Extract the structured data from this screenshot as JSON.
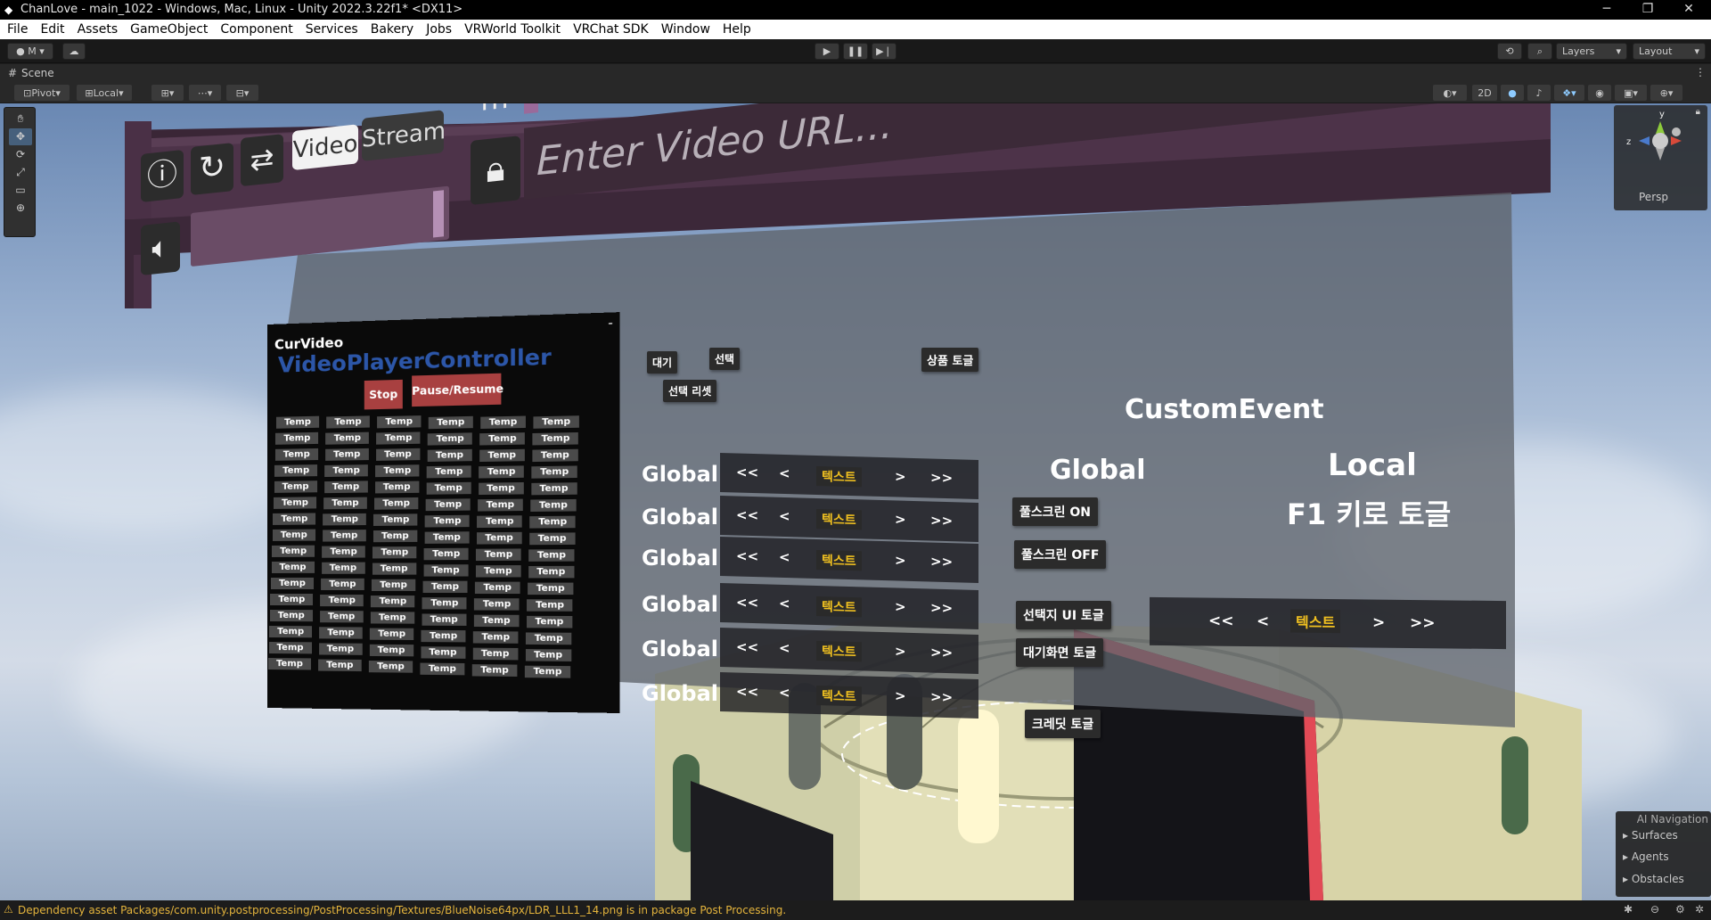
{
  "window": {
    "title": "ChanLove - main_1022 - Windows, Mac, Linux - Unity 2022.3.22f1* <DX11>",
    "minimize": "─",
    "maximize": "❐",
    "close": "✕"
  },
  "menu": [
    "File",
    "Edit",
    "Assets",
    "GameObject",
    "Component",
    "Services",
    "Bakery",
    "Jobs",
    "VRWorld Toolkit",
    "VRChat SDK",
    "Window",
    "Help"
  ],
  "toolbar": {
    "account": "M",
    "layers": "Layers",
    "layout": "Layout"
  },
  "scene": {
    "tab_label": "Scene",
    "pivot": "Pivot",
    "local": "Local",
    "two_d": "2D",
    "persp": "Persp"
  },
  "ai_navigation": {
    "title": "AI Navigation",
    "items": [
      "Surfaces",
      "Agents",
      "Obstacles"
    ]
  },
  "video_player": {
    "tab_video": "Video",
    "tab_stream": "Stream",
    "url_placeholder": "Enter Video URL..."
  },
  "curvideo": {
    "title": "CurVideo",
    "subtitle": "VideoPlayerController",
    "stop": "Stop",
    "pause_resume": "Pause/Resume",
    "cell": "Temp",
    "rows": 16,
    "cols": 6
  },
  "buttons": {
    "wait": "대기",
    "select": "선택",
    "select_reset": "선택 리셋",
    "product_toggle": "상품 토글",
    "fullscreen_on": "풀스크린 ON",
    "fullscreen_off": "풀스크린 OFF",
    "intro_ui_toggle": "선택지 UI 토글",
    "standby_toggle": "대기화면 토글",
    "credit_toggle": "크레딧 토글"
  },
  "headings": {
    "custom_event": "CustomEvent",
    "global": "Global",
    "local": "Local",
    "f1_toggle": "F1 키로 토글"
  },
  "row_label": "Global",
  "row_controls": {
    "first": "<<",
    "prev": "<",
    "text": "텍스트",
    "next": ">",
    "last": ">>"
  },
  "status": {
    "message": "Dependency asset Packages/com.unity.postprocessing/PostProcessing/Textures/BlueNoise64px/LDR_LLL1_14.png is in package Post Processing."
  },
  "colors": {
    "accent": "#f0c020",
    "warning": "#e4b43c",
    "panel_purple": "#4d3349",
    "stop_red": "#a84040"
  }
}
